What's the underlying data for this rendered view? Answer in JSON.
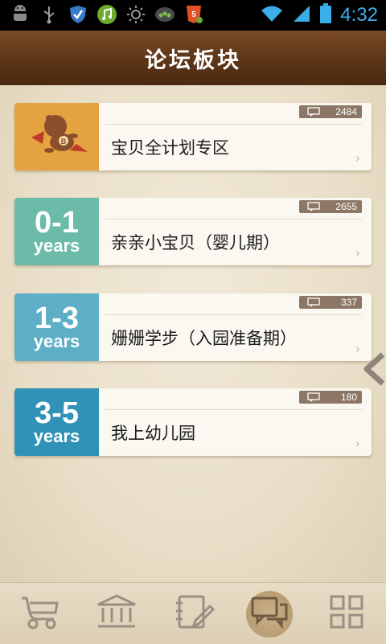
{
  "status_bar": {
    "time": "4:32",
    "icons": [
      "android-debug-icon",
      "usb-icon",
      "shield-icon",
      "music-icon",
      "brightness-icon",
      "pea-pod-icon",
      "html5-icon",
      "wifi-icon",
      "signal-icon",
      "battery-icon"
    ]
  },
  "header": {
    "title": "论坛板块"
  },
  "forums": [
    {
      "title": "宝贝全计划专区",
      "count": "2484",
      "badge_range": "",
      "badge_years": "",
      "color": "#e4a240",
      "icon": "mascot-icon"
    },
    {
      "title": "亲亲小宝贝（婴儿期）",
      "count": "2655",
      "badge_range": "0-1",
      "badge_years": "years",
      "color": "#6bbba8"
    },
    {
      "title": "姗姗学步（入园准备期）",
      "count": "337",
      "badge_range": "1-3",
      "badge_years": "years",
      "color": "#5daec7"
    },
    {
      "title": "我上幼儿园",
      "count": "180",
      "badge_range": "3-5",
      "badge_years": "years",
      "color": "#2f92b6"
    }
  ],
  "bottom_nav": {
    "items": [
      "stroller-icon",
      "bank-icon",
      "notebook-icon",
      "forum-chat-icon",
      "grid-icon"
    ],
    "active_index": 3
  }
}
